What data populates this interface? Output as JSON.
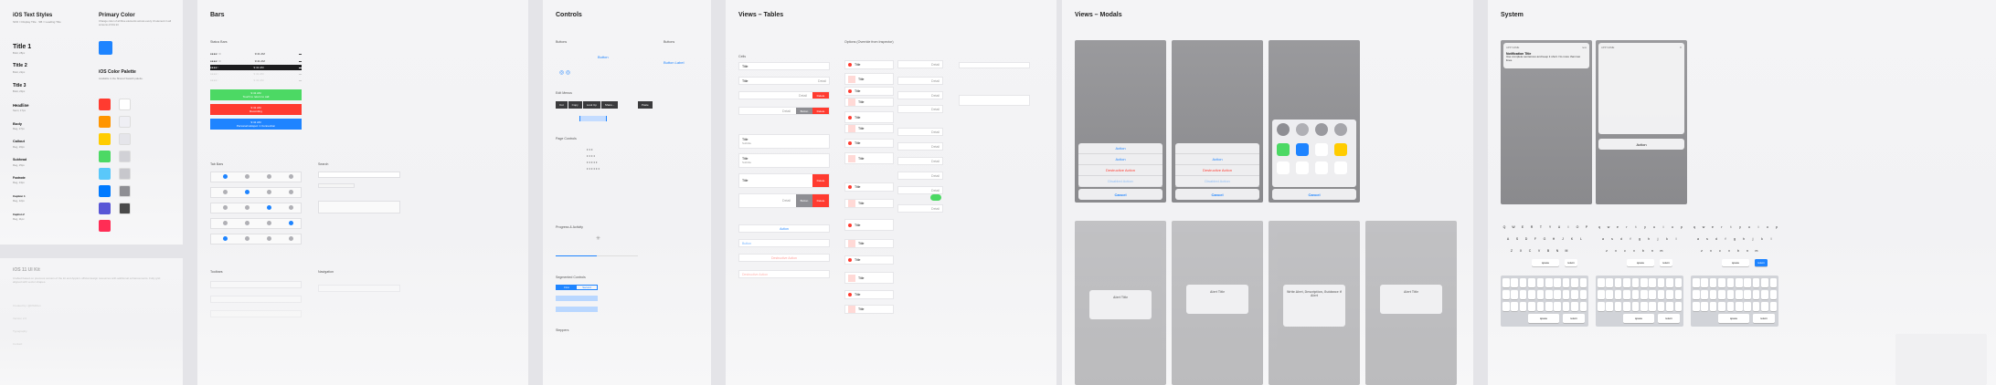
{
  "panels": {
    "p1_title": "iOS Text Styles",
    "p1_sub": "SFD = Display Title · SB = Leading Title",
    "primary_color_title": "Primary Color",
    "primary_color_desc": "Change color of all blue elements across every UI element in all screens of this kit",
    "palette_title": "iOS Color Palette",
    "palette_desc": "Available in the Shared Swatch palette.",
    "text_styles": [
      {
        "name": "Title 1",
        "sub": "Bold, 28px",
        "size": 7
      },
      {
        "name": "Title 2",
        "sub": "Bold, 22px",
        "size": 5.5
      },
      {
        "name": "Title 3",
        "sub": "Bold, 20px",
        "size": 5
      },
      {
        "name": "Headline",
        "sub": "Semi, 17px",
        "size": 4.2
      },
      {
        "name": "Body",
        "sub": "Reg, 17px",
        "size": 4
      },
      {
        "name": "Callout",
        "sub": "Reg, 16px",
        "size": 3.8
      },
      {
        "name": "Subhead",
        "sub": "Reg, 15px",
        "size": 3.6
      },
      {
        "name": "Footnote",
        "sub": "Reg, 13px",
        "size": 3.2
      },
      {
        "name": "Caption 1",
        "sub": "Reg, 12px",
        "size": 3
      },
      {
        "name": "Caption 2",
        "sub": "Reg, 11px",
        "size": 2.8
      }
    ],
    "colors": {
      "primary": "#1e84ff",
      "palette_left": [
        "#ff3b30",
        "#ff9500",
        "#ffcc00",
        "#4cd964",
        "#5ac8fa",
        "#007aff",
        "#5856d6",
        "#ff2d55"
      ],
      "palette_right": [
        "#ffffff",
        "#efeff4",
        "#e5e5ea",
        "#d1d1d6",
        "#c7c7cc",
        "#8e8e93",
        "#4a4a4a",
        "#000000"
      ]
    },
    "ui_kit_title": "iOS 11 UI Kit",
    "ui_kit_desc": "Crafted based on previous version of the kit and Apple's official design resources with additional enhancements. Fully grid aligned with vector shapes.",
    "ui_kit_lines": [
      "Created by: @DS2Ron",
      "Version 2.0",
      "Typography",
      "Contact"
    ],
    "bars_title": "Bars",
    "status_bars": "Status Bars",
    "tab_bars": "Tab Bars",
    "toolbars": "Toolbars",
    "search": "Search",
    "navigation": "Navigation",
    "time": "9:41 AM",
    "in_call": "Touch to return to call",
    "personal_hotspot": "Personal Hotspot: 1 Connection",
    "recording": "Recording",
    "controls_title": "Controls",
    "buttons": "Buttons",
    "button": "Button",
    "button_label": "Button Label",
    "edit_menus": "Edit Menus",
    "edit_items": [
      "Cut",
      "Copy",
      "Look Up",
      "Share..."
    ],
    "paste": "Paste",
    "page_controls": "Page Controls",
    "progress": "Progress & Activity",
    "segmented": "Segmented Controls",
    "first": "First",
    "second": "Second",
    "steppers": "Steppers",
    "views_tables_title": "Views – Tables",
    "cells": "Cells",
    "options": "Options (Override from Inspector)",
    "title": "Title",
    "detail": "Detail",
    "subtitle": "Subtitle",
    "delete": "Delete",
    "action": "Action",
    "button_cell": "Button",
    "destructive_action": "Destructive Action",
    "views_modals_title": "Views – Modals",
    "cancel": "Cancel",
    "disabled_action": "Disabled Action",
    "alert_title": "Alert Title",
    "alert_long": "Write Alert, Description, Guidance if Alert",
    "system_title": "System",
    "notification_title": "Notification Title",
    "notification_body": "Use complete sentences and keep it short. No more than two lines.",
    "app_name": "APP NAME",
    "now": "now",
    "space": "space",
    "return": "return"
  }
}
